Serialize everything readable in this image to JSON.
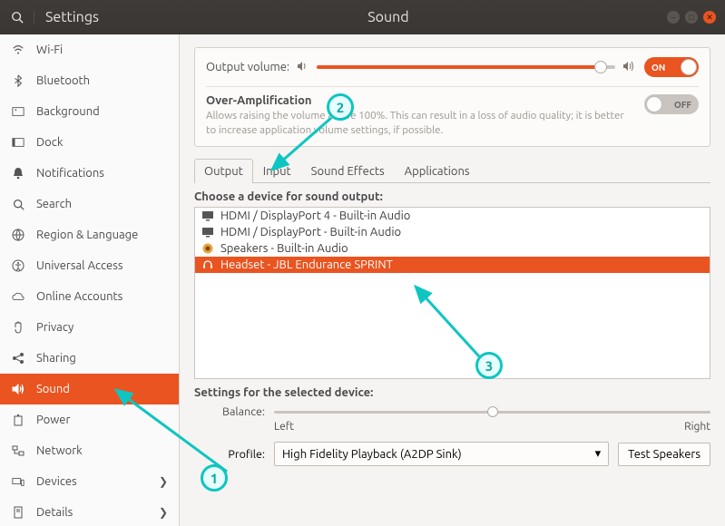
{
  "window": {
    "app_title": "Settings",
    "page_title": "Sound"
  },
  "sidebar": {
    "items": [
      {
        "label": "Wi-Fi"
      },
      {
        "label": "Bluetooth"
      },
      {
        "label": "Background"
      },
      {
        "label": "Dock"
      },
      {
        "label": "Notifications"
      },
      {
        "label": "Search"
      },
      {
        "label": "Region & Language"
      },
      {
        "label": "Universal Access"
      },
      {
        "label": "Online Accounts"
      },
      {
        "label": "Privacy"
      },
      {
        "label": "Sharing"
      },
      {
        "label": "Sound"
      },
      {
        "label": "Power"
      },
      {
        "label": "Network"
      },
      {
        "label": "Devices"
      },
      {
        "label": "Details"
      }
    ]
  },
  "volume": {
    "label": "Output volume:",
    "toggle_on_text": "ON",
    "toggle_off_text": "OFF"
  },
  "overamp": {
    "title": "Over-Amplification",
    "desc": "Allows raising the volume above 100%. This can result in a loss of audio quality; it is better to increase application volume settings, if possible."
  },
  "tabs": {
    "output": "Output",
    "input": "Input",
    "effects": "Sound Effects",
    "apps": "Applications"
  },
  "output": {
    "choose_label": "Choose a device for sound output:",
    "devices": [
      "HDMI / DisplayPort 4 - Built-in Audio",
      "HDMI / DisplayPort - Built-in Audio",
      "Speakers - Built-in Audio",
      "Headset - JBL Endurance SPRINT"
    ],
    "settings_label": "Settings for the selected device:",
    "balance_label": "Balance:",
    "left_label": "Left",
    "right_label": "Right",
    "profile_label": "Profile:",
    "profile_value": "High Fidelity Playback (A2DP Sink)",
    "test_label": "Test Speakers"
  },
  "annotations": [
    "1",
    "2",
    "3"
  ]
}
